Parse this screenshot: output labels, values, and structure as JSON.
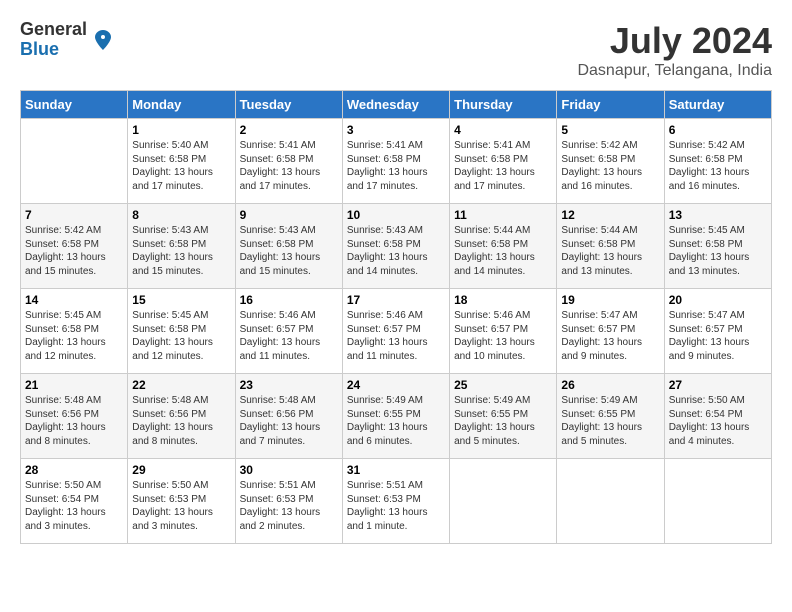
{
  "logo": {
    "general": "General",
    "blue": "Blue"
  },
  "title": {
    "month_year": "July 2024",
    "location": "Dasnapur, Telangana, India"
  },
  "days_of_week": [
    "Sunday",
    "Monday",
    "Tuesday",
    "Wednesday",
    "Thursday",
    "Friday",
    "Saturday"
  ],
  "weeks": [
    [
      {
        "day": "",
        "info": ""
      },
      {
        "day": "1",
        "info": "Sunrise: 5:40 AM\nSunset: 6:58 PM\nDaylight: 13 hours\nand 17 minutes."
      },
      {
        "day": "2",
        "info": "Sunrise: 5:41 AM\nSunset: 6:58 PM\nDaylight: 13 hours\nand 17 minutes."
      },
      {
        "day": "3",
        "info": "Sunrise: 5:41 AM\nSunset: 6:58 PM\nDaylight: 13 hours\nand 17 minutes."
      },
      {
        "day": "4",
        "info": "Sunrise: 5:41 AM\nSunset: 6:58 PM\nDaylight: 13 hours\nand 17 minutes."
      },
      {
        "day": "5",
        "info": "Sunrise: 5:42 AM\nSunset: 6:58 PM\nDaylight: 13 hours\nand 16 minutes."
      },
      {
        "day": "6",
        "info": "Sunrise: 5:42 AM\nSunset: 6:58 PM\nDaylight: 13 hours\nand 16 minutes."
      }
    ],
    [
      {
        "day": "7",
        "info": "Sunrise: 5:42 AM\nSunset: 6:58 PM\nDaylight: 13 hours\nand 15 minutes."
      },
      {
        "day": "8",
        "info": "Sunrise: 5:43 AM\nSunset: 6:58 PM\nDaylight: 13 hours\nand 15 minutes."
      },
      {
        "day": "9",
        "info": "Sunrise: 5:43 AM\nSunset: 6:58 PM\nDaylight: 13 hours\nand 15 minutes."
      },
      {
        "day": "10",
        "info": "Sunrise: 5:43 AM\nSunset: 6:58 PM\nDaylight: 13 hours\nand 14 minutes."
      },
      {
        "day": "11",
        "info": "Sunrise: 5:44 AM\nSunset: 6:58 PM\nDaylight: 13 hours\nand 14 minutes."
      },
      {
        "day": "12",
        "info": "Sunrise: 5:44 AM\nSunset: 6:58 PM\nDaylight: 13 hours\nand 13 minutes."
      },
      {
        "day": "13",
        "info": "Sunrise: 5:45 AM\nSunset: 6:58 PM\nDaylight: 13 hours\nand 13 minutes."
      }
    ],
    [
      {
        "day": "14",
        "info": "Sunrise: 5:45 AM\nSunset: 6:58 PM\nDaylight: 13 hours\nand 12 minutes."
      },
      {
        "day": "15",
        "info": "Sunrise: 5:45 AM\nSunset: 6:58 PM\nDaylight: 13 hours\nand 12 minutes."
      },
      {
        "day": "16",
        "info": "Sunrise: 5:46 AM\nSunset: 6:57 PM\nDaylight: 13 hours\nand 11 minutes."
      },
      {
        "day": "17",
        "info": "Sunrise: 5:46 AM\nSunset: 6:57 PM\nDaylight: 13 hours\nand 11 minutes."
      },
      {
        "day": "18",
        "info": "Sunrise: 5:46 AM\nSunset: 6:57 PM\nDaylight: 13 hours\nand 10 minutes."
      },
      {
        "day": "19",
        "info": "Sunrise: 5:47 AM\nSunset: 6:57 PM\nDaylight: 13 hours\nand 9 minutes."
      },
      {
        "day": "20",
        "info": "Sunrise: 5:47 AM\nSunset: 6:57 PM\nDaylight: 13 hours\nand 9 minutes."
      }
    ],
    [
      {
        "day": "21",
        "info": "Sunrise: 5:48 AM\nSunset: 6:56 PM\nDaylight: 13 hours\nand 8 minutes."
      },
      {
        "day": "22",
        "info": "Sunrise: 5:48 AM\nSunset: 6:56 PM\nDaylight: 13 hours\nand 8 minutes."
      },
      {
        "day": "23",
        "info": "Sunrise: 5:48 AM\nSunset: 6:56 PM\nDaylight: 13 hours\nand 7 minutes."
      },
      {
        "day": "24",
        "info": "Sunrise: 5:49 AM\nSunset: 6:55 PM\nDaylight: 13 hours\nand 6 minutes."
      },
      {
        "day": "25",
        "info": "Sunrise: 5:49 AM\nSunset: 6:55 PM\nDaylight: 13 hours\nand 5 minutes."
      },
      {
        "day": "26",
        "info": "Sunrise: 5:49 AM\nSunset: 6:55 PM\nDaylight: 13 hours\nand 5 minutes."
      },
      {
        "day": "27",
        "info": "Sunrise: 5:50 AM\nSunset: 6:54 PM\nDaylight: 13 hours\nand 4 minutes."
      }
    ],
    [
      {
        "day": "28",
        "info": "Sunrise: 5:50 AM\nSunset: 6:54 PM\nDaylight: 13 hours\nand 3 minutes."
      },
      {
        "day": "29",
        "info": "Sunrise: 5:50 AM\nSunset: 6:53 PM\nDaylight: 13 hours\nand 3 minutes."
      },
      {
        "day": "30",
        "info": "Sunrise: 5:51 AM\nSunset: 6:53 PM\nDaylight: 13 hours\nand 2 minutes."
      },
      {
        "day": "31",
        "info": "Sunrise: 5:51 AM\nSunset: 6:53 PM\nDaylight: 13 hours\nand 1 minute."
      },
      {
        "day": "",
        "info": ""
      },
      {
        "day": "",
        "info": ""
      },
      {
        "day": "",
        "info": ""
      }
    ]
  ]
}
